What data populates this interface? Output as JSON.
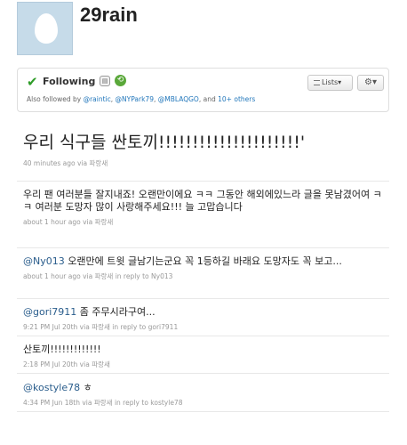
{
  "profile": {
    "username": "29rain"
  },
  "follow_box": {
    "following_label": "Following",
    "also_followed_prefix": "Also followed by",
    "also_followed_users": [
      "@raintic",
      "@NYPark79",
      "@MBLAQGO"
    ],
    "also_followed_and": "and",
    "also_followed_others": "10+ others",
    "lists_label": "Lists▾",
    "gear_label": "⚙▾"
  },
  "tweets": [
    {
      "text": "우리 식구들 싼토끼!!!!!!!!!!!!!!!!!!!!!'",
      "time": "40 minutes ago",
      "via_label": "via",
      "source": "파랑새",
      "reply": ""
    },
    {
      "text": "우리 팬 여러분들 잘지내죠! 오랜만이에요 ㅋㅋ 그동안 해외에있느라 글을 못남겼어여 ㅋㅋ 여러분 도망자 많이 사랑해주세요!!! 늘 고맙습니다",
      "time": "about 1 hour ago",
      "via_label": "via",
      "source": "파랑새",
      "reply": ""
    },
    {
      "mention": "@Ny013",
      "text": " 오랜만에 트윗 글남기는군요 꼭 1등하길 바래요 도망자도 꼭 보고...",
      "time": "about 1 hour ago",
      "via_label": "via",
      "source": "파랑새",
      "reply": "in reply to Ny013"
    },
    {
      "mention": "@gori7911",
      "text": " 좀 주무시라구여...",
      "time": "9:21 PM Jul 20th",
      "via_label": "via",
      "source": "파랑새",
      "reply": "in reply to gori7911"
    },
    {
      "text": "산토끼!!!!!!!!!!!!!",
      "time": "2:18 PM Jul 20th",
      "via_label": "via",
      "source": "파랑새",
      "reply": ""
    },
    {
      "mention": "@kostyle78",
      "text": " ㅎ",
      "time": "4:34 PM Jun 18th",
      "via_label": "via",
      "source": "파랑새",
      "reply": "in reply to kostyle78"
    }
  ]
}
